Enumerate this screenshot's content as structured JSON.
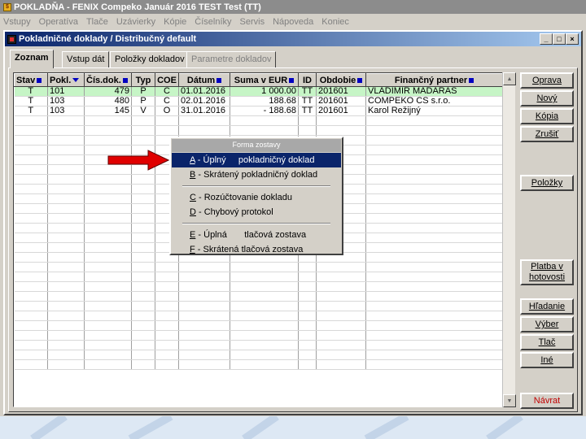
{
  "app": {
    "title": "POKLADŇA - FENIX Compeko   Január 2016   TEST Test  (TT)",
    "menu": [
      "Vstupy",
      "Operatíva",
      "Tlače",
      "Uzávierky",
      "Kópie",
      "Číselníky",
      "Servis",
      "Nápoveda",
      "Koniec"
    ]
  },
  "window": {
    "title": "Pokladničné doklady / Distribučný default",
    "controls": [
      "_",
      "□",
      "×"
    ]
  },
  "tabs": [
    {
      "label": "Zoznam",
      "active": true
    },
    {
      "label": "Vstup dát"
    },
    {
      "label": "Položky dokladov"
    },
    {
      "label": "Parametre dokladov",
      "disabled": true
    }
  ],
  "grid": {
    "columns": [
      "Stav",
      "Pokl.",
      "Čís.dok.",
      "Typ",
      "COE",
      "Dátum",
      "Suma v EUR",
      "ID",
      "Obdobie",
      "Finančný partner"
    ],
    "rows": [
      [
        "T",
        "101",
        "479",
        "P",
        "C",
        "01.01.2016",
        "1 000.00",
        "TT",
        "201601",
        "VLADIMÍR MADARAS"
      ],
      [
        "T",
        "103",
        "480",
        "P",
        "C",
        "02.01.2016",
        "188.68",
        "TT",
        "201601",
        "COMPEKO CS s.r.o."
      ],
      [
        "T",
        "103",
        "145",
        "V",
        "O",
        "31.01.2016",
        "- 188.68",
        "TT",
        "201601",
        "Karol Režijný"
      ]
    ],
    "selected_row": 0
  },
  "buttons": {
    "oprava": "Oprava",
    "novy": "Nový",
    "kopia": "Kópia",
    "zrusit": "Zrušiť",
    "polozky": "Položky",
    "platba1": "Platba v",
    "platba2": "hotovosti",
    "hladanie": "Hľadanie",
    "vyber": "Výber",
    "tlac": "Tlač",
    "ine": "Iné",
    "navrat": "Návrat"
  },
  "popup": {
    "title": "Forma zostavy",
    "items": [
      {
        "key": "A",
        "text": " - Úplný     pokladničný doklad"
      },
      {
        "key": "B",
        "text": " - Skrátený pokladničný doklad"
      },
      {
        "key": "C",
        "text": " - Rozúčtovanie dokladu"
      },
      {
        "key": "D",
        "text": " - Chybový protokol"
      },
      {
        "key": "E",
        "text": " - Úplná       tlačová zostava"
      },
      {
        "key": "F",
        "text": " - Skrátená tlačová zostava"
      }
    ],
    "highlighted": 0
  },
  "colors": {
    "selected_row": "#c6f5c6",
    "menu_highlight": "#0a246a",
    "title_gradient_start": "#0a246a",
    "arrow": "#e00000"
  }
}
